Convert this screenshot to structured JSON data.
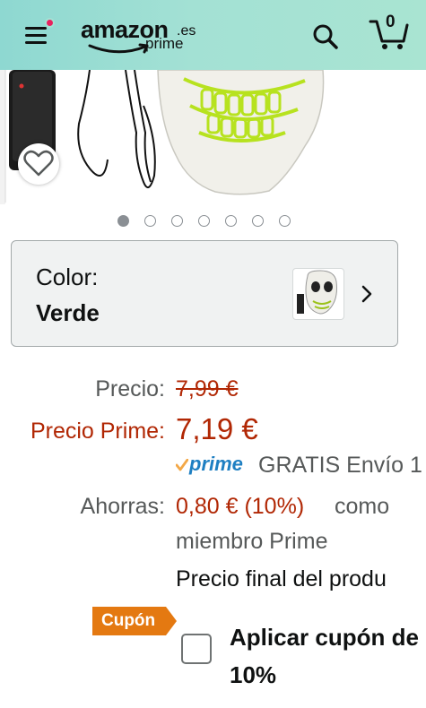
{
  "header": {
    "logo_main": "amazon",
    "logo_es": ".es",
    "logo_prime": "prime",
    "cart_count": "0",
    "icons": [
      "menu-icon",
      "search-icon",
      "cart-icon"
    ],
    "background": "#a3e1d4",
    "notification_dot_color": "#e8215e"
  },
  "gallery": {
    "total_images": 7,
    "active_index": 0
  },
  "color_selector": {
    "label": "Color:",
    "value": "Verde"
  },
  "pricing": {
    "price_label": "Precio:",
    "price_value": "7,99 €",
    "prime_label": "Precio Prime:",
    "prime_value": "7,19 €",
    "prime_badge": "prime",
    "shipping": "GRATIS Envío 1",
    "savings_label": "Ahorras:",
    "savings_value": "0,80 € (10%)",
    "savings_suffix": "como",
    "savings_suffix2": "miembro Prime",
    "final_price_text": "Precio final del produ"
  },
  "coupon": {
    "badge": "Cupón",
    "text_line1": "Aplicar cupón de",
    "text_line2": "10%",
    "checked": false
  },
  "colors": {
    "red_price": "#b12704",
    "prime_blue": "#1e7fc2",
    "coupon_orange": "#e47911"
  }
}
